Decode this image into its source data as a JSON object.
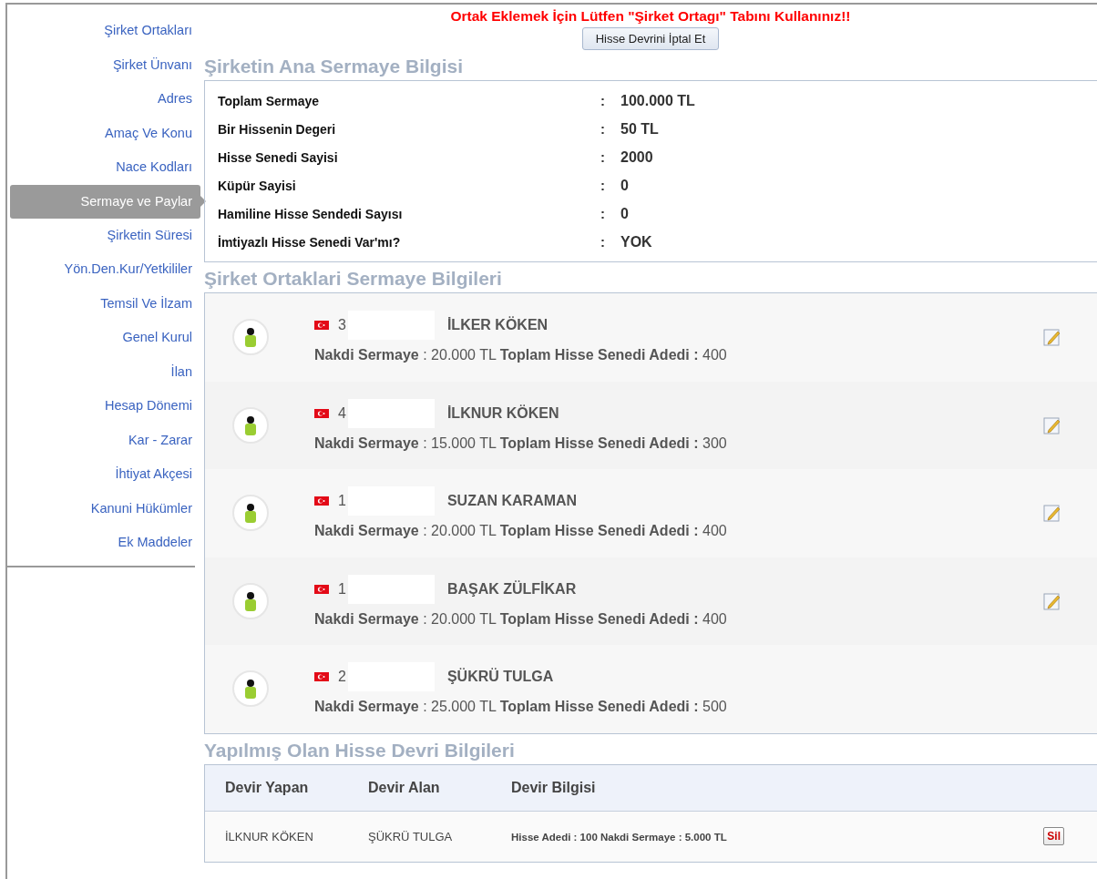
{
  "sidebar": {
    "items": [
      {
        "label": "Şirket Ortakları",
        "selected": false
      },
      {
        "label": "Şirket Ünvanı",
        "selected": false
      },
      {
        "label": "Adres",
        "selected": false
      },
      {
        "label": "Amaç Ve Konu",
        "selected": false
      },
      {
        "label": "Nace Kodları",
        "selected": false
      },
      {
        "label": "Sermaye ve Paylar",
        "selected": true
      },
      {
        "label": "Şirketin Süresi",
        "selected": false
      },
      {
        "label": "Yön.Den.Kur/Yetkililer",
        "selected": false
      },
      {
        "label": "Temsil Ve İlzam",
        "selected": false
      },
      {
        "label": "Genel Kurul",
        "selected": false
      },
      {
        "label": "İlan",
        "selected": false
      },
      {
        "label": "Hesap Dönemi",
        "selected": false
      },
      {
        "label": "Kar - Zarar",
        "selected": false
      },
      {
        "label": "İhtiyat Akçesi",
        "selected": false
      },
      {
        "label": "Kanuni Hükümler",
        "selected": false
      },
      {
        "label": "Ek Maddeler",
        "selected": false
      }
    ]
  },
  "warning": "Ortak Eklemek İçin Lütfen \"Şirket Ortagı\" Tabını Kullanınız!!",
  "cancel_button": "Hisse Devrini İptal Et",
  "capital_section": {
    "title": "Şirketin Ana Sermaye Bilgisi",
    "rows": [
      {
        "label": "Toplam Sermaye",
        "separator": ":",
        "value": "100.000 TL"
      },
      {
        "label": "Bir Hissenin Degeri",
        "separator": ":",
        "value": "50 TL"
      },
      {
        "label": "Hisse Senedi Sayisi",
        "separator": ":",
        "value": "2000"
      },
      {
        "label": "Küpür Sayisi",
        "separator": ":",
        "value": "0"
      },
      {
        "label": "Hamiline Hisse Sendedi Sayısı",
        "separator": ":",
        "value": "0"
      },
      {
        "label": "İmtiyazlı Hisse Senedi Var'mı?",
        "separator": ":",
        "value": "YOK"
      }
    ]
  },
  "partners_section": {
    "title": "Şirket Ortaklari Sermaye Bilgileri",
    "partners": [
      {
        "id": "3",
        "name": "İLKER KÖKEN",
        "cash_label": "Nakdi Sermaye",
        "cash_value": ": 20.000 TL",
        "shares_label": "Toplam Hisse Senedi Adedi :",
        "shares_value": "400",
        "editable": true
      },
      {
        "id": "4",
        "name": "İLKNUR KÖKEN",
        "cash_label": "Nakdi Sermaye",
        "cash_value": ": 15.000 TL",
        "shares_label": "Toplam Hisse Senedi Adedi :",
        "shares_value": "300",
        "editable": true
      },
      {
        "id": "1",
        "name": "SUZAN KARAMAN",
        "cash_label": "Nakdi Sermaye",
        "cash_value": ": 20.000 TL",
        "shares_label": "Toplam Hisse Senedi Adedi :",
        "shares_value": "400",
        "editable": true
      },
      {
        "id": "1",
        "name": "BAŞAK ZÜLFİKAR",
        "cash_label": "Nakdi Sermaye",
        "cash_value": ": 20.000 TL",
        "shares_label": "Toplam Hisse Senedi Adedi :",
        "shares_value": "400",
        "editable": true
      },
      {
        "id": "2",
        "name": "ŞÜKRÜ TULGA",
        "cash_label": "Nakdi Sermaye",
        "cash_value": ": 25.000 TL",
        "shares_label": "Toplam Hisse Senedi Adedi :",
        "shares_value": "500",
        "editable": false
      }
    ]
  },
  "transfers_section": {
    "title": "Yapılmış Olan Hisse Devri Bilgileri",
    "columns": [
      "Devir Yapan",
      "Devir Alan",
      "Devir Bilgisi"
    ],
    "rows": [
      {
        "from": "İLKNUR KÖKEN",
        "to": "ŞÜKRÜ TULGA",
        "info": "Hisse Adedi : 100 Nakdi Sermaye : 5.000 TL",
        "delete_button": "Sil"
      }
    ]
  }
}
